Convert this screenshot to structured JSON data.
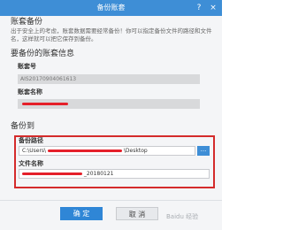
{
  "window": {
    "title": "备份账套",
    "close_icon": "×",
    "help_icon": "?"
  },
  "intro": {
    "heading": "账套备份",
    "description": "出于安全上的考虑，账套数据需要经常备份！你可以指定备份文件的路径和文件名，这样就可以把它保存到备份。"
  },
  "account_info": {
    "heading": "要备份的账套信息",
    "account_number_label": "账套号",
    "account_number_value": "AIS20170904061613",
    "account_name_label": "账套名称",
    "account_name_value": ""
  },
  "backup_to": {
    "heading": "备份到",
    "path_label": "备份路径",
    "path_value_prefix": "C:\\Users\\",
    "path_value_suffix": "\\Desktop",
    "browse_label": "...",
    "filename_label": "文件名称",
    "filename_value_suffix": "_20180121"
  },
  "buttons": {
    "confirm": "确 定",
    "cancel": "取 消"
  },
  "watermark": "Baidu 经验"
}
